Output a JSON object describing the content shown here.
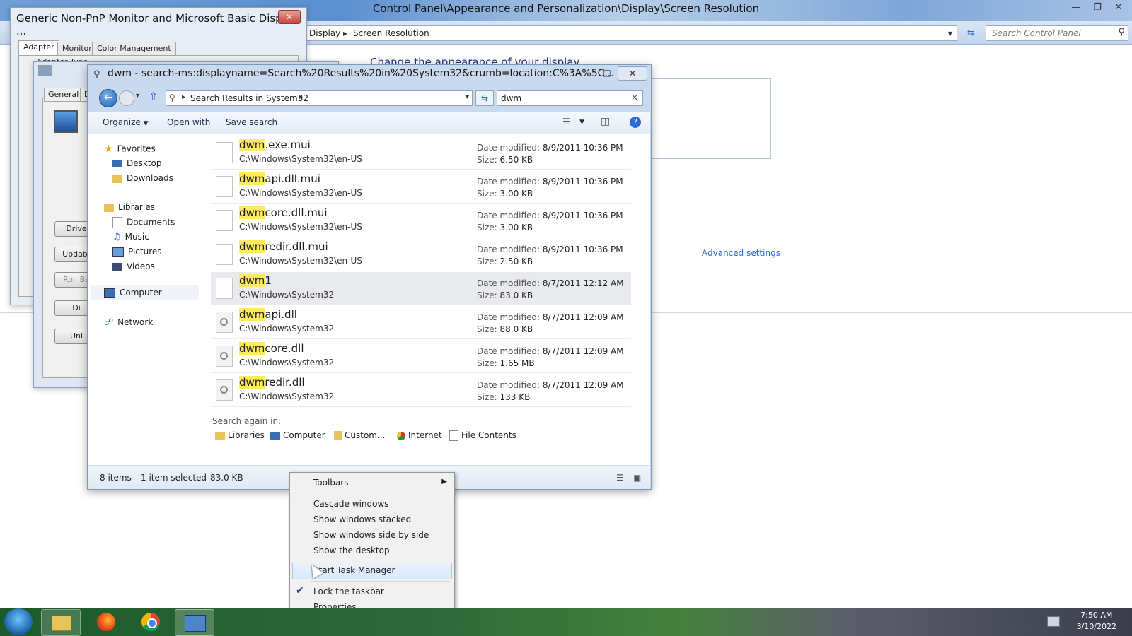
{
  "control_panel": {
    "title": "Control Panel\\Appearance and Personalization\\Display\\Screen Resolution",
    "breadcrumb": [
      "Display",
      "Screen Resolution"
    ],
    "search_placeholder": "Search Control Panel",
    "heading": "Change the appearance of your display",
    "advanced_link": "Advanced settings"
  },
  "monitor_dialog": {
    "title": "Generic Non-PnP Monitor and Microsoft Basic Display ...",
    "tabs": [
      "Adapter",
      "Monitor",
      "Color Management"
    ],
    "adapter_type_label": "Adapter Type"
  },
  "driver_dialog": {
    "tabs": [
      "General",
      "D"
    ],
    "buttons": [
      "Drive",
      "Update",
      "Roll Ba",
      "Di",
      "Uni"
    ]
  },
  "explorer": {
    "title": "dwm - search-ms:displayname=Search%20Results%20in%20System32&crumb=location:C%3A%5C...",
    "crumb": "Search Results in System32",
    "search_value": "dwm",
    "toolbar": {
      "organize": "Organize",
      "open_with": "Open with",
      "save_search": "Save search"
    },
    "nav": {
      "favorites": "Favorites",
      "desktop": "Desktop",
      "downloads": "Downloads",
      "libraries": "Libraries",
      "documents": "Documents",
      "music": "Music",
      "pictures": "Pictures",
      "videos": "Videos",
      "computer": "Computer",
      "network": "Network"
    },
    "date_label": "Date modified:",
    "size_label": "Size:",
    "files": [
      {
        "hl": "dwm",
        "rest": ".exe.mui",
        "path": "C:\\Windows\\System32\\en-US",
        "date": "8/9/2011 10:36 PM",
        "size": "6.50 KB",
        "type": "mui"
      },
      {
        "hl": "dwm",
        "rest": "api.dll.mui",
        "path": "C:\\Windows\\System32\\en-US",
        "date": "8/9/2011 10:36 PM",
        "size": "3.00 KB",
        "type": "mui"
      },
      {
        "hl": "dwm",
        "rest": "core.dll.mui",
        "path": "C:\\Windows\\System32\\en-US",
        "date": "8/9/2011 10:36 PM",
        "size": "3.00 KB",
        "type": "mui"
      },
      {
        "hl": "dwm",
        "rest": "redir.dll.mui",
        "path": "C:\\Windows\\System32\\en-US",
        "date": "8/9/2011 10:36 PM",
        "size": "2.50 KB",
        "type": "mui"
      },
      {
        "hl": "dwm",
        "rest": "1",
        "path": "C:\\Windows\\System32",
        "date": "8/7/2011 12:12 AM",
        "size": "83.0 KB",
        "type": "file",
        "selected": true
      },
      {
        "hl": "dwm",
        "rest": "api.dll",
        "path": "C:\\Windows\\System32",
        "date": "8/7/2011 12:09 AM",
        "size": "88.0 KB",
        "type": "dll"
      },
      {
        "hl": "dwm",
        "rest": "core.dll",
        "path": "C:\\Windows\\System32",
        "date": "8/7/2011 12:09 AM",
        "size": "1.65 MB",
        "type": "dll"
      },
      {
        "hl": "dwm",
        "rest": "redir.dll",
        "path": "C:\\Windows\\System32",
        "date": "8/7/2011 12:09 AM",
        "size": "133 KB",
        "type": "dll"
      }
    ],
    "search_again_label": "Search again in:",
    "search_again": [
      "Libraries",
      "Computer",
      "Custom...",
      "Internet",
      "File Contents"
    ],
    "status": {
      "items": "8 items",
      "selected": "1 item selected",
      "selected_size": "83.0 KB"
    }
  },
  "context_menu": {
    "items": [
      "Toolbars",
      "Cascade windows",
      "Show windows stacked",
      "Show windows side by side",
      "Show the desktop",
      "Start Task Manager",
      "Lock the taskbar",
      "Properties"
    ]
  },
  "taskbar": {
    "time": "7:50 AM",
    "date": "3/10/2022"
  },
  "colors": {
    "highlight": "#ffec5c",
    "link": "#2a6bd3",
    "selected_row": "#e8eaee"
  }
}
